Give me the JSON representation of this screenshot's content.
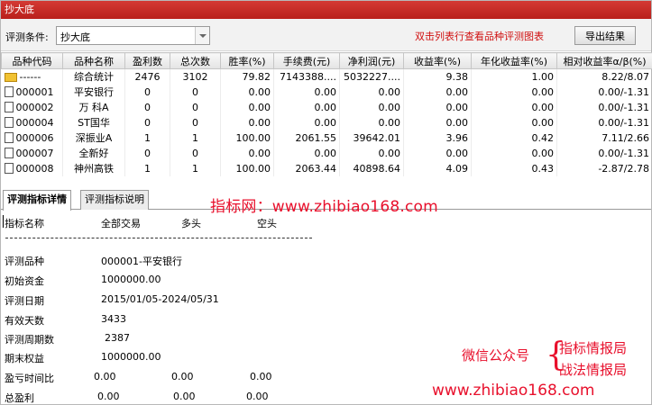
{
  "window": {
    "title": "抄大底"
  },
  "toolbar": {
    "condition_label": "评测条件:",
    "condition_value": "抄大底",
    "hint": "双击列表行查看品种评测图表",
    "export_label": "导出结果"
  },
  "table": {
    "columns": [
      "品种代码",
      "品种名称",
      "盈利数",
      "总次数",
      "胜率(%)",
      "手续费(元)",
      "净利润(元)",
      "收益率(%)",
      "年化收益率(%)",
      "相对收益率α/β(%)"
    ],
    "rows": [
      [
        "------",
        "综合统计",
        "2476",
        "3102",
        "79.82",
        "7143388....",
        "5032227....",
        "9.38",
        "1.00",
        "8.22/8.07"
      ],
      [
        "000001",
        "平安银行",
        "0",
        "0",
        "0.00",
        "0.00",
        "0.00",
        "0.00",
        "0.00",
        "0.00/-1.31"
      ],
      [
        "000002",
        "万 科A",
        "0",
        "0",
        "0.00",
        "0.00",
        "0.00",
        "0.00",
        "0.00",
        "0.00/-1.31"
      ],
      [
        "000004",
        "ST国华",
        "0",
        "0",
        "0.00",
        "0.00",
        "0.00",
        "0.00",
        "0.00",
        "0.00/-1.31"
      ],
      [
        "000006",
        "深振业A",
        "1",
        "1",
        "100.00",
        "2061.55",
        "39642.01",
        "3.96",
        "0.42",
        "7.11/2.66"
      ],
      [
        "000007",
        "全新好",
        "0",
        "0",
        "0.00",
        "0.00",
        "0.00",
        "0.00",
        "0.00",
        "0.00/-1.31"
      ],
      [
        "000008",
        "神州高铁",
        "1",
        "1",
        "100.00",
        "2063.44",
        "40898.64",
        "4.09",
        "0.43",
        "-2.87/2.78"
      ]
    ]
  },
  "tabs": [
    {
      "label": "评测指标详情",
      "active": true
    },
    {
      "label": "评测指标说明",
      "active": false
    }
  ],
  "watermark": {
    "top": "指标网：www.zhibiao168.com",
    "wechat": "微信公众号",
    "brace": "{",
    "r1": "指标情报局",
    "r2": "战法情报局",
    "bottom": "www.zhibiao168.com"
  },
  "detail": {
    "headers": [
      "指标名称",
      "全部交易",
      "多头",
      "空头"
    ],
    "rows": [
      {
        "label": "评测品种",
        "value": "000001-平安银行"
      },
      {
        "label": "初始资金",
        "value": "1000000.00"
      },
      {
        "label": "评测日期",
        "value": "2015/01/05-2024/05/31"
      },
      {
        "label": "有效天数",
        "value": "3433"
      },
      {
        "label": "评测周期数",
        "value": "2387"
      },
      {
        "label": "期末权益",
        "value": "1000000.00"
      },
      {
        "label": "盈亏时间比",
        "v1": "0.00",
        "v2": "0.00",
        "v3": "0.00"
      },
      {
        "label": "总盈利",
        "v1": "0.00",
        "v2": "0.00",
        "v3": "0.00"
      }
    ]
  }
}
